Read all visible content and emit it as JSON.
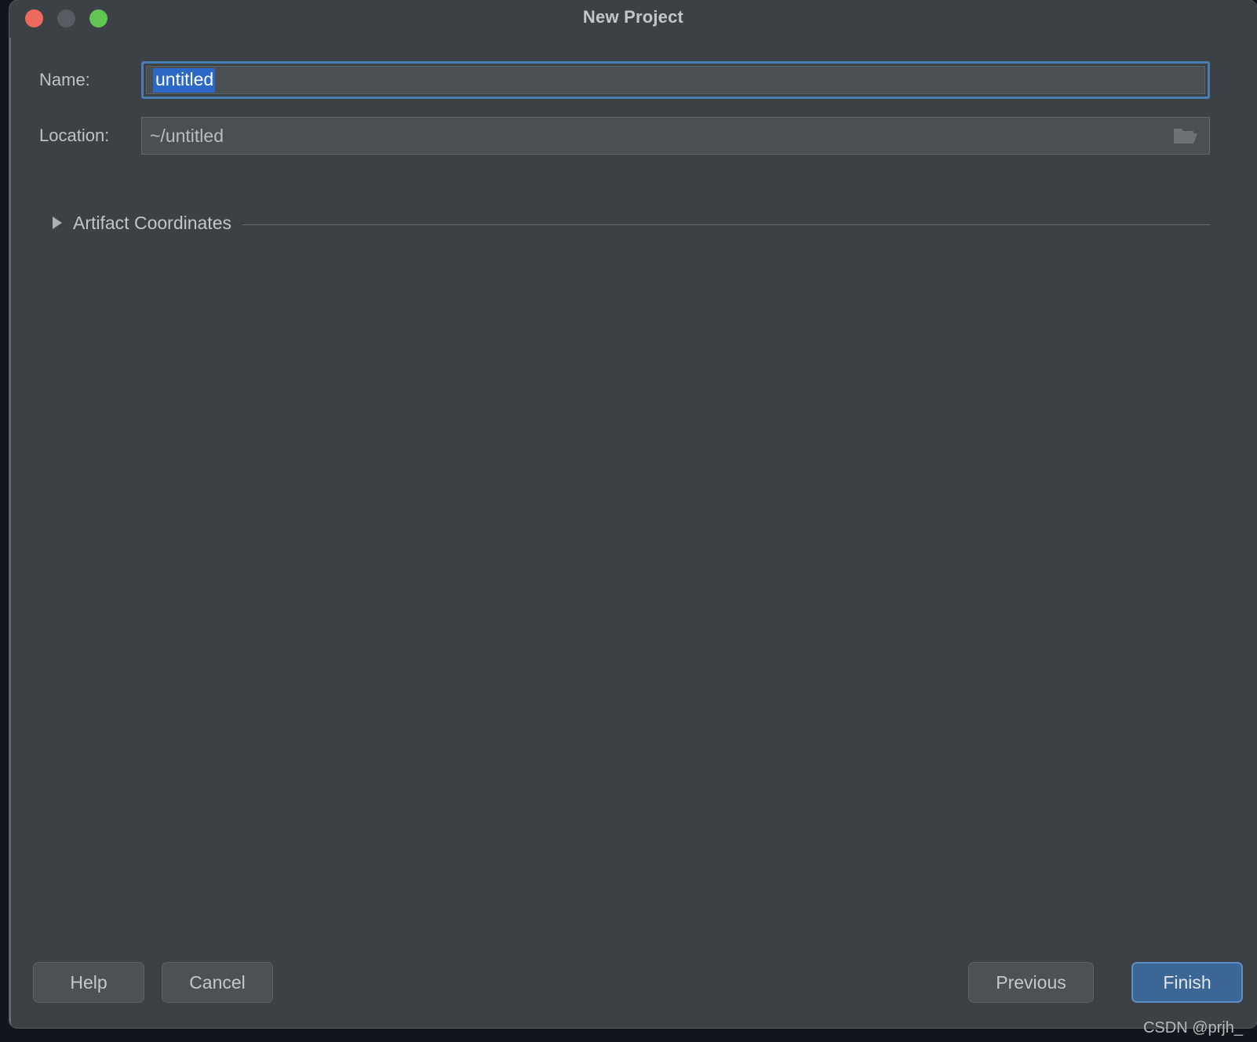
{
  "window": {
    "title": "New Project",
    "traffic_lights": [
      {
        "name": "close",
        "color": "#ec6a5e"
      },
      {
        "name": "minimize",
        "color": "#565c61"
      },
      {
        "name": "zoom",
        "color": "#61c554"
      }
    ]
  },
  "form": {
    "name": {
      "label": "Name:",
      "value": "untitled",
      "placeholder": "untitled",
      "selected": true,
      "focused": true,
      "selection_color": "#2c68c8",
      "focus_ring_color": "#4a7fb5"
    },
    "location": {
      "label": "Location:",
      "value": "~/untitled",
      "placeholder": "~/untitled",
      "browse_icon": "folder-open-icon"
    }
  },
  "section": {
    "title": "Artifact Coordinates",
    "expanded": false,
    "toggle_icon": "triangle-right-icon"
  },
  "buttons": {
    "help": "Help",
    "cancel": "Cancel",
    "previous": "Previous",
    "finish": "Finish",
    "finish_color": "#3c6695"
  },
  "watermark": "CSDN @prjh_"
}
